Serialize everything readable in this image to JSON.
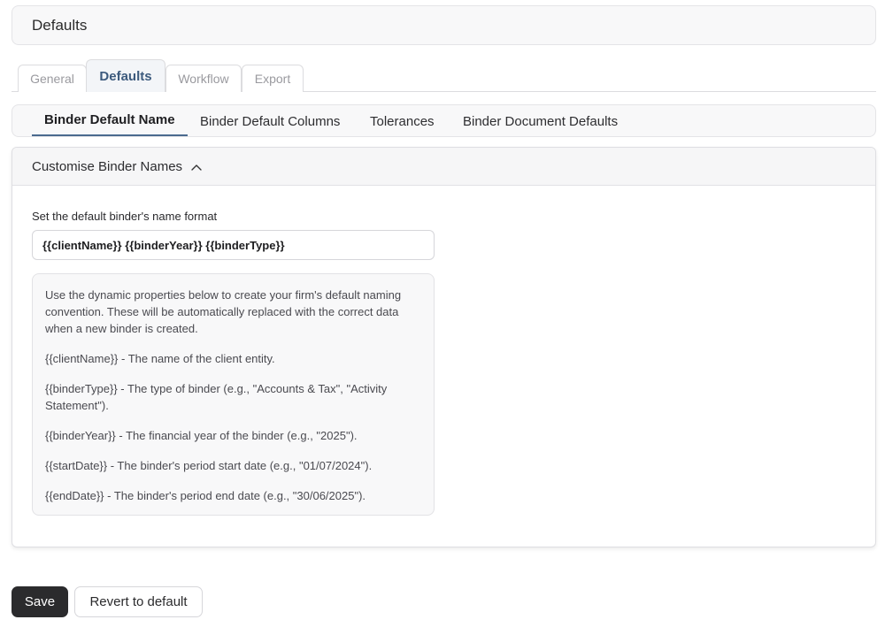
{
  "header": {
    "title": "Defaults"
  },
  "tabs": [
    {
      "label": "General"
    },
    {
      "label": "Defaults",
      "active": true
    },
    {
      "label": "Workflow"
    },
    {
      "label": "Export"
    }
  ],
  "subtabs": [
    {
      "label": "Binder Default Name",
      "active": true
    },
    {
      "label": "Binder Default Columns"
    },
    {
      "label": "Tolerances"
    },
    {
      "label": "Binder Document Defaults"
    }
  ],
  "panel": {
    "title": "Customise Binder Names",
    "chevron_icon": "chevron-up-icon",
    "expanded": true,
    "field_label": "Set the default binder's name format",
    "name_format_value": "{{clientName}} {{binderYear}} {{binderType}}",
    "help": {
      "intro": "Use the dynamic properties below to create your firm's default naming convention. These will be automatically replaced with the correct data when a new binder is created.",
      "properties": [
        "{{clientName}} - The name of the client entity.",
        "{{binderType}} - The type of binder (e.g., \"Accounts & Tax\", \"Activity Statement\").",
        "{{binderYear}} - The financial year of the binder (e.g., \"2025\").",
        "{{startDate}} - The binder's period start date (e.g., \"01/07/2024\").",
        "{{endDate}} - The binder's period end date (e.g., \"30/06/2025\")."
      ]
    }
  },
  "actions": {
    "save_label": "Save",
    "revert_label": "Revert to default"
  },
  "colors": {
    "active_tab_text": "#3c5a7d",
    "active_subtab_underline": "#4a6a8f",
    "primary_button": "#2b2b2d"
  }
}
